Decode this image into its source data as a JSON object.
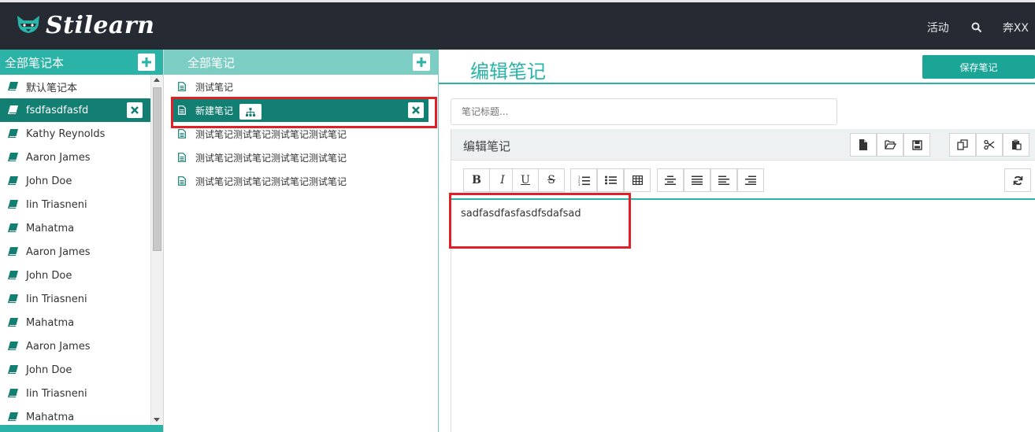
{
  "topbar": {
    "logo_text": "Stilearn",
    "nav_activity": "活动",
    "user_name": "奔XX"
  },
  "notebooks": {
    "header": "全部笔记本",
    "items": [
      {
        "label": "默认笔记本"
      },
      {
        "label": "fsdfasdfasfd",
        "active": true
      },
      {
        "label": "Kathy Reynolds"
      },
      {
        "label": "Aaron James"
      },
      {
        "label": "John Doe"
      },
      {
        "label": "Iin Triasneni"
      },
      {
        "label": "Mahatma"
      },
      {
        "label": "Aaron James"
      },
      {
        "label": "John Doe"
      },
      {
        "label": "Iin Triasneni"
      },
      {
        "label": "Mahatma"
      },
      {
        "label": "Aaron James"
      },
      {
        "label": "John Doe"
      },
      {
        "label": "Iin Triasneni"
      },
      {
        "label": "Mahatma"
      }
    ]
  },
  "notes": {
    "header": "全部笔记",
    "items": [
      {
        "label": "测试笔记"
      },
      {
        "label": "新建笔记",
        "active": true
      },
      {
        "label": "测试笔记测试笔记测试笔记测试笔记"
      },
      {
        "label": "测试笔记测试笔记测试笔记测试笔记"
      },
      {
        "label": "测试笔记测试笔记测试笔记测试笔记"
      }
    ]
  },
  "editor": {
    "title": "编辑笔记",
    "save_label": "保存笔记",
    "title_placeholder": "笔记标题...",
    "panel_label": "编辑笔记",
    "content": "sadfasdfasfasdfsdafsad"
  },
  "colors": {
    "accent": "#2ab3a6",
    "active_row": "#137e72",
    "topbar": "#262a33",
    "highlight_box": "#e01f26"
  }
}
